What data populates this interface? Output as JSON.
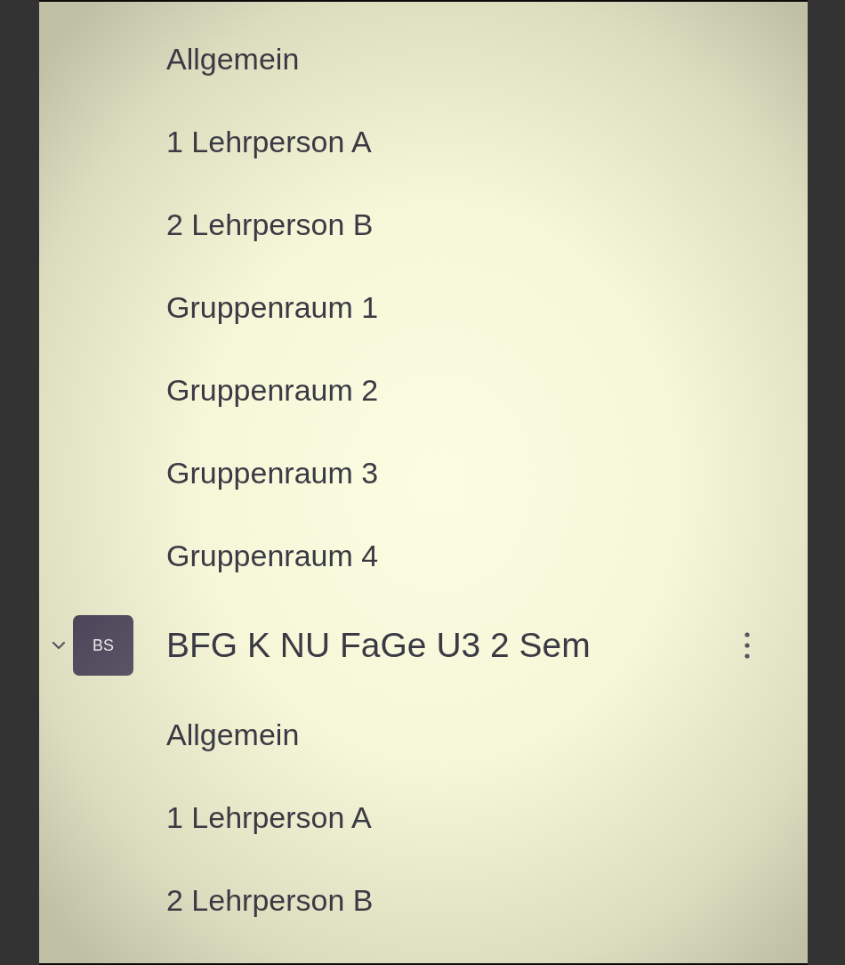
{
  "channels": [
    {
      "name": "Allgemein"
    },
    {
      "name": "1 Lehrperson A"
    },
    {
      "name": "2 Lehrperson B"
    },
    {
      "name": "Gruppenraum 1"
    },
    {
      "name": "Gruppenraum 2"
    },
    {
      "name": "Gruppenraum 3"
    },
    {
      "name": "Gruppenraum 4"
    }
  ],
  "teams": [
    {
      "avatar": "BS",
      "name": "BFG K NU FaGe U3 2 Sem",
      "expanded": true,
      "channels": [
        {
          "name": "Allgemein"
        },
        {
          "name": "1 Lehrperson A"
        },
        {
          "name": "2 Lehrperson B"
        }
      ]
    }
  ]
}
